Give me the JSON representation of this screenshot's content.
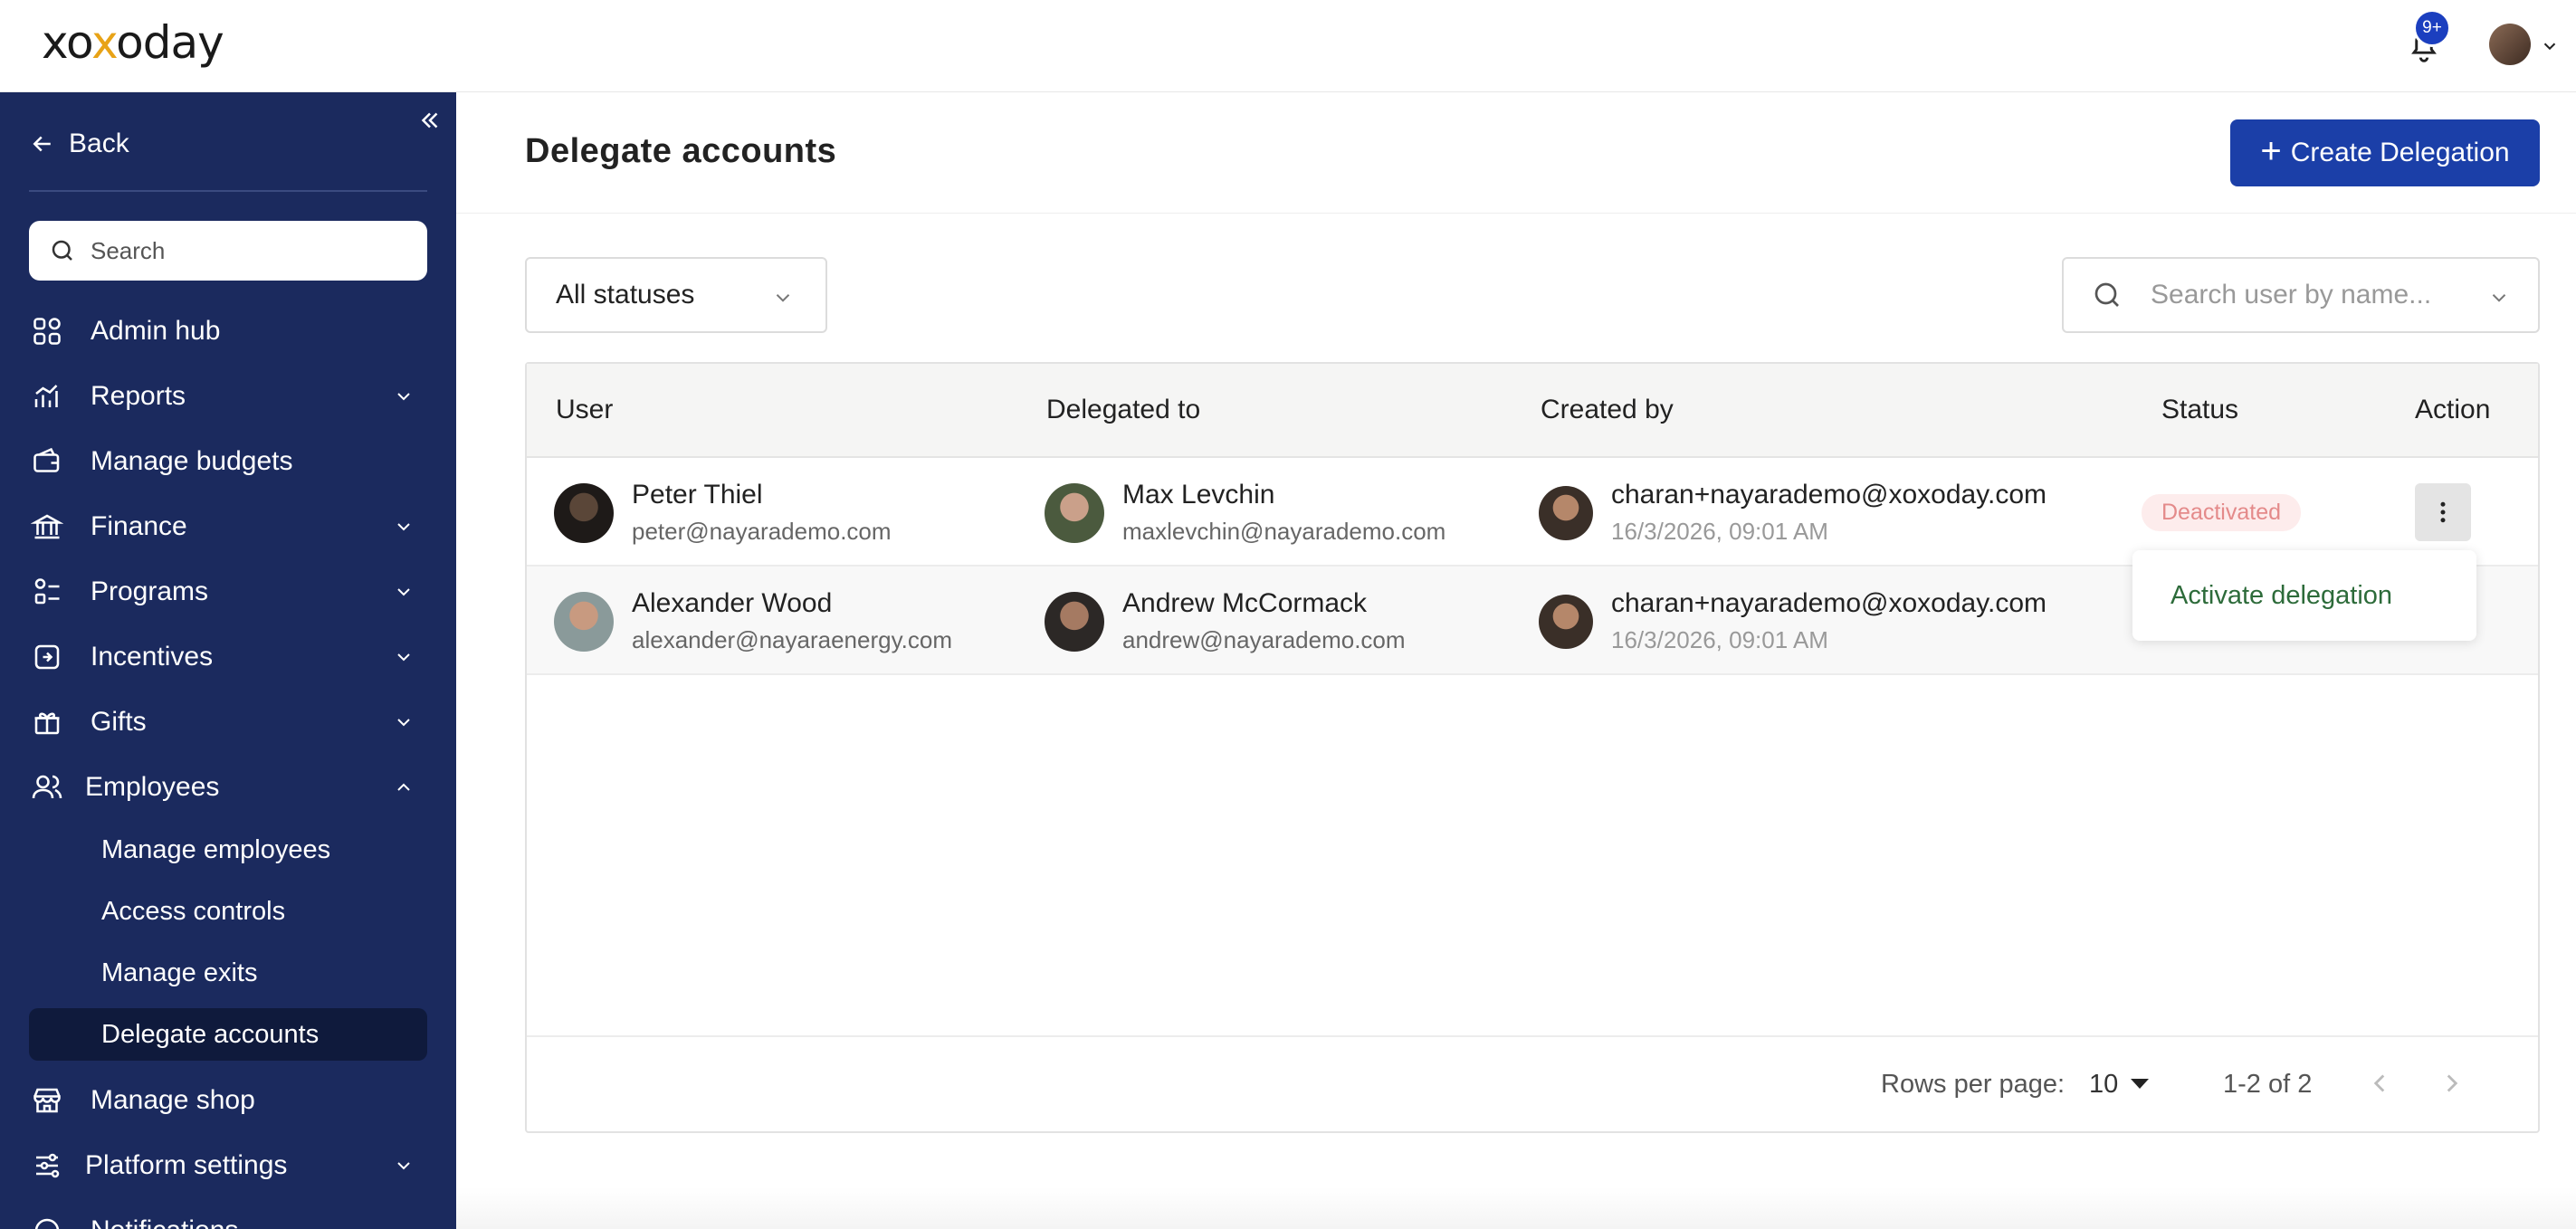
{
  "app": {
    "logo": "xoxoday",
    "notification_count": "9+"
  },
  "sidebar": {
    "back_label": "Back",
    "search_placeholder": "Search",
    "items": [
      {
        "label": "Admin hub",
        "icon": "grid-icon",
        "expandable": false
      },
      {
        "label": "Reports",
        "icon": "chart-icon",
        "expandable": true
      },
      {
        "label": "Manage budgets",
        "icon": "wallet-icon",
        "expandable": false
      },
      {
        "label": "Finance",
        "icon": "bank-icon",
        "expandable": true
      },
      {
        "label": "Programs",
        "icon": "programs-icon",
        "expandable": true
      },
      {
        "label": "Incentives",
        "icon": "incentive-icon",
        "expandable": true
      },
      {
        "label": "Gifts",
        "icon": "gift-icon",
        "expandable": true
      },
      {
        "label": "Employees",
        "icon": "users-icon",
        "expandable": true,
        "expanded": true
      }
    ],
    "employee_sub_items": [
      {
        "label": "Manage employees"
      },
      {
        "label": "Access controls"
      },
      {
        "label": "Manage exits"
      },
      {
        "label": "Delegate accounts",
        "active": true
      }
    ],
    "after_items": [
      {
        "label": "Manage shop",
        "icon": "shop-icon",
        "expandable": false
      },
      {
        "label": "Platform settings",
        "icon": "settings-sliders-icon",
        "expandable": true
      },
      {
        "label": "Notifications",
        "icon": "notification-icon",
        "expandable": false
      }
    ]
  },
  "page": {
    "title": "Delegate accounts",
    "create_button_label": "Create Delegation",
    "status_filter_value": "All statuses",
    "user_search_placeholder": "Search user by name..."
  },
  "table": {
    "columns": [
      "User",
      "Delegated to",
      "Created by",
      "Status",
      "Action"
    ],
    "rows": [
      {
        "user_name": "Peter Thiel",
        "user_email": "peter@nayarademo.com",
        "delegate_name": "Max Levchin",
        "delegate_email": "maxlevchin@nayarademo.com",
        "created_by": "charan+nayarademo@xoxoday.com",
        "created_at": "16/3/2026, 09:01 AM",
        "status": "Deactivated"
      },
      {
        "user_name": "Alexander Wood",
        "user_email": "alexander@nayaraenergy.com",
        "delegate_name": "Andrew McCormack",
        "delegate_email": "andrew@nayarademo.com",
        "created_by": "charan+nayarademo@xoxoday.com",
        "created_at": "16/3/2026, 09:01 AM",
        "status": ""
      }
    ],
    "action_menu_item": "Activate delegation"
  },
  "pagination": {
    "rows_per_page_label": "Rows per page:",
    "rows_per_page_value": "10",
    "range": "1-2 of 2"
  },
  "colors": {
    "sidebar_bg": "#1b2a5e",
    "primary": "#1b3fa8",
    "deactivated_text": "#e48a8a",
    "activate_text": "#2d6b3a"
  }
}
